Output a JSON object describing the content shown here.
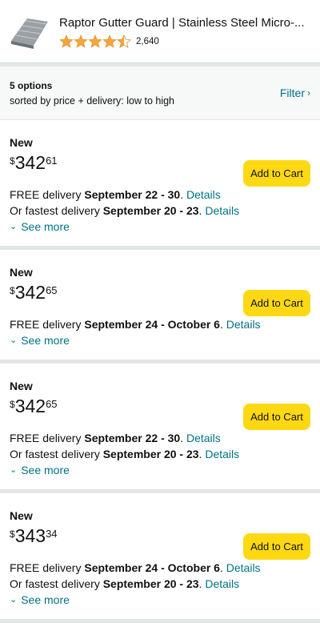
{
  "product": {
    "title": "Raptor Gutter Guard | Stainless Steel Micro-...",
    "rating_count": "2,640",
    "stars": 4.5
  },
  "options": {
    "count": "5 options",
    "sort": "sorted by price + delivery: low to high",
    "filter_label": "Filter"
  },
  "offers": [
    {
      "condition": "New",
      "currency": "$",
      "whole": "342",
      "fraction": "61",
      "add_label": "Add to Cart",
      "free_prefix": "FREE delivery ",
      "free_dates": "September 22 - 30",
      "details": "Details",
      "fast_prefix": "Or fastest delivery ",
      "fast_dates": "September 20 - 23",
      "see_more": "See more"
    },
    {
      "condition": "New",
      "currency": "$",
      "whole": "342",
      "fraction": "65",
      "add_label": "Add to Cart",
      "free_prefix": "FREE delivery ",
      "free_dates": "September 24 - October 6",
      "details": "Details",
      "see_more": "See more"
    },
    {
      "condition": "New",
      "currency": "$",
      "whole": "342",
      "fraction": "65",
      "add_label": "Add to Cart",
      "free_prefix": "FREE delivery ",
      "free_dates": "September 22 - 30",
      "details": "Details",
      "fast_prefix": "Or fastest delivery ",
      "fast_dates": "September 20 - 23",
      "see_more": "See more"
    },
    {
      "condition": "New",
      "currency": "$",
      "whole": "343",
      "fraction": "34",
      "add_label": "Add to Cart",
      "free_prefix": "FREE delivery ",
      "free_dates": "September 24 - October 6",
      "details": "Details",
      "fast_prefix": "Or fastest delivery ",
      "fast_dates": "September 20 - 23",
      "see_more": "See more"
    }
  ],
  "colors": {
    "link": "#007185",
    "button": "#ffd814",
    "star": "#f7a53b"
  },
  "icons": {
    "star": "star-icon",
    "chevron_right": "chevron-right-icon",
    "chevron_down": "chevron-down-icon"
  }
}
